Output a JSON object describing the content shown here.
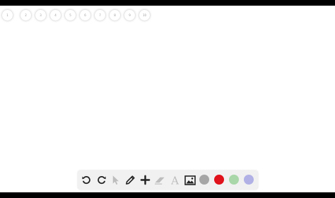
{
  "pages": [
    {
      "label": "1"
    },
    {
      "label": "2"
    },
    {
      "label": "3"
    },
    {
      "label": "4"
    },
    {
      "label": "5"
    },
    {
      "label": "6"
    },
    {
      "label": "7"
    },
    {
      "label": "8"
    },
    {
      "label": "9"
    },
    {
      "label": "10"
    }
  ],
  "toolbar": {
    "tools": [
      {
        "name": "undo-icon"
      },
      {
        "name": "redo-icon"
      },
      {
        "name": "pointer-icon"
      },
      {
        "name": "pencil-icon"
      },
      {
        "name": "plus-icon"
      },
      {
        "name": "eraser-icon"
      },
      {
        "name": "text-icon",
        "glyph": "A"
      },
      {
        "name": "image-icon"
      }
    ],
    "colors": [
      {
        "name": "gray",
        "hex": "#a6a6a6"
      },
      {
        "name": "red",
        "hex": "#e0121b"
      },
      {
        "name": "light-green",
        "hex": "#a9d7a9"
      },
      {
        "name": "lavender",
        "hex": "#b1b1e6"
      }
    ]
  },
  "colors": {
    "letterbox": "#000000",
    "canvas": "#ffffff",
    "toolbar_bg": "#f1f1f1",
    "icon_active": "#222222",
    "icon_disabled": "#bdbdbd"
  }
}
